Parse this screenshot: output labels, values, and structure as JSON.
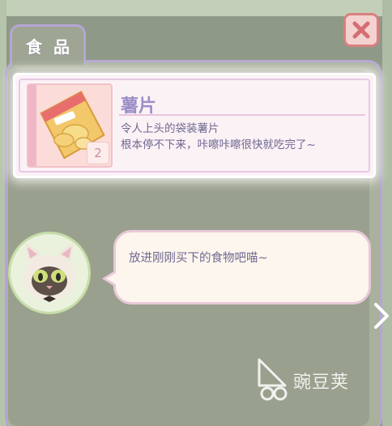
{
  "tab": {
    "label": "食品"
  },
  "item": {
    "name": "薯片",
    "description_line1": "令人上头的袋装薯片",
    "description_line2": "根本停不下来，咔嚓咔嚓很快就吃完了~",
    "count": "2",
    "thumb_icon": "chips-bag-icon"
  },
  "dialog": {
    "text": "放进刚刚买下的食物吧喵~"
  },
  "watermark": {
    "text": "豌豆荚"
  },
  "colors": {
    "accent_lavender": "#b5a6d3",
    "close_red": "#d98080",
    "text_purple": "#6f6890",
    "panel_bg": "#a9b09c"
  }
}
